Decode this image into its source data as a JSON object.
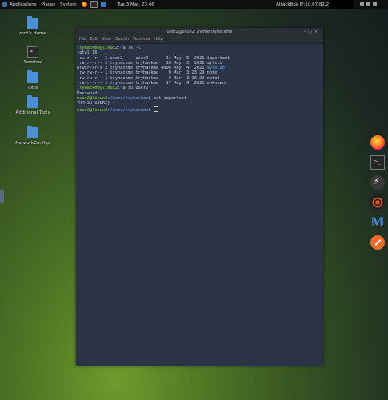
{
  "topbar": {
    "applications": "Applications",
    "places": "Places",
    "system": "System",
    "clock": "Tue 3 Mar, 23:46",
    "ip": "AttackBox IP:10.67.82.204"
  },
  "desktop": {
    "icons": [
      {
        "label": "root's Home",
        "icon": "folder-icon"
      },
      {
        "label": "Terminal",
        "icon": "terminal-icon"
      },
      {
        "label": "Tools",
        "icon": "folder-icon"
      },
      {
        "label": "Additional Tools",
        "icon": "folder-link-icon"
      },
      {
        "label": "NetworkConfigs",
        "icon": "folder-icon"
      }
    ]
  },
  "terminal": {
    "title": "user2@linux2: /home/tryhackme",
    "menu": [
      "File",
      "Edit",
      "View",
      "Search",
      "Terminal",
      "Help"
    ],
    "lines": {
      "l1_prompt": "tryhackme@linux2",
      "l1_path": "~",
      "l1_cmd": "$ ls -l",
      "l2": "total 16",
      "l3": "-rw-r--r-- 1 user2     user2       14 May  5  2021 important",
      "l4": "-rw-r--r-- 1 tryhackme tryhackme   16 May  5  2021 myfile",
      "l5a": "drwxr-xr-x 2 tryhackme tryhackme 4096 May  4  2021 ",
      "l5b": "myfolder",
      "l6": "-rw-rw-r-- 1 tryhackme tryhackme    0 Mar  3 23:29 note",
      "l7": "-rw-rw-r-- 1 tryhackme tryhackme    0 Mar  3 23:29 note3",
      "l8": "-rw-r--r-- 1 tryhackme tryhackme   17 May  4  2021 unknown1",
      "l9_prompt": "tryhackme@linux2",
      "l9_path": "~",
      "l9_cmd": "$ su user2",
      "l10": "Password:",
      "l11_prompt": "user2@linux2",
      "l11_path": "/home/tryhackme",
      "l11_cmd": "$ cat important",
      "l12": "THM{SU_USER2}",
      "l13_prompt": "user2@linux2",
      "l13_path": "/home/tryhackme",
      "l13_cmd": "$ "
    }
  },
  "dock": [
    "firefox-icon",
    "terminal-icon",
    "burp-suite-icon",
    "target-icon",
    "metasploit-icon",
    "zap-icon",
    "kali-icon"
  ]
}
